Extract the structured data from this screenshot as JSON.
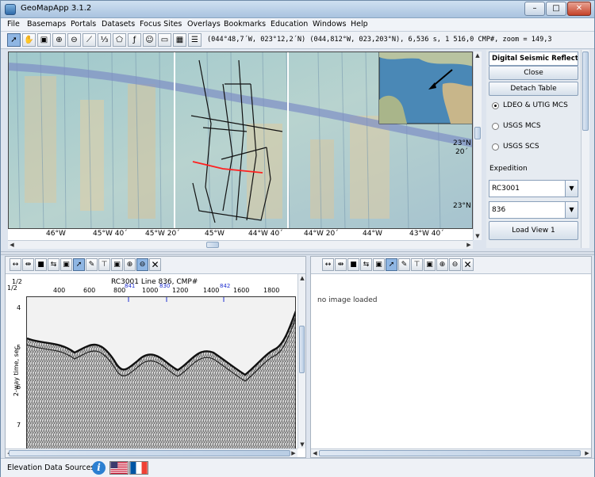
{
  "window": {
    "title": "GeoMapApp 3.1.2"
  },
  "menu": [
    "File",
    "Basemaps",
    "Portals",
    "Datasets",
    "Focus Sites",
    "Overlays",
    "Bookmarks",
    "Education",
    "Windows",
    "Help"
  ],
  "toolbar": {
    "coords": "(044°48,7´W, 023°12,2´N) (044,812°W, 023,203°N), 6,536 s, 1 516,0 CMP#, zoom = 149,3"
  },
  "map": {
    "lat_labels": [
      "23°N",
      "20´",
      "23°N"
    ],
    "lon_labels": [
      "46°W",
      "45°W 40´",
      "45°W 20´",
      "45°W",
      "44°W 40´",
      "44°W 20´",
      "44°W",
      "43°W 40´"
    ]
  },
  "panel": {
    "title": "Digital Seismic Reflectio...",
    "close": "Close",
    "detach": "Detach Table",
    "radios": [
      {
        "label": "LDEO & UTIG MCS",
        "selected": true
      },
      {
        "label": "USGS MCS",
        "selected": false
      },
      {
        "label": "USGS SCS",
        "selected": false
      }
    ],
    "expedition_label": "Expedition",
    "expedition": "RC3001",
    "line": "836",
    "load": "Load View 1"
  },
  "seismic": {
    "title": "RC3001 Line 836, CMP#",
    "cmp_ticks": [
      "400",
      "600",
      "800",
      "1000",
      "1200",
      "1400",
      "1600",
      "1800"
    ],
    "marks": [
      "841",
      "830",
      "842"
    ],
    "ylabel": "2-way time, sec",
    "time_ticks": [
      "4",
      "5",
      "6",
      "7"
    ],
    "zoom_left": "1/2",
    "zoom_left2": "1/2"
  },
  "right_pane": {
    "message": "no image loaded"
  },
  "status": {
    "label": "Elevation Data Sources",
    "info": "i"
  },
  "colors": {
    "accent": "#2b7fd1",
    "ship_track": "#ff2020"
  }
}
